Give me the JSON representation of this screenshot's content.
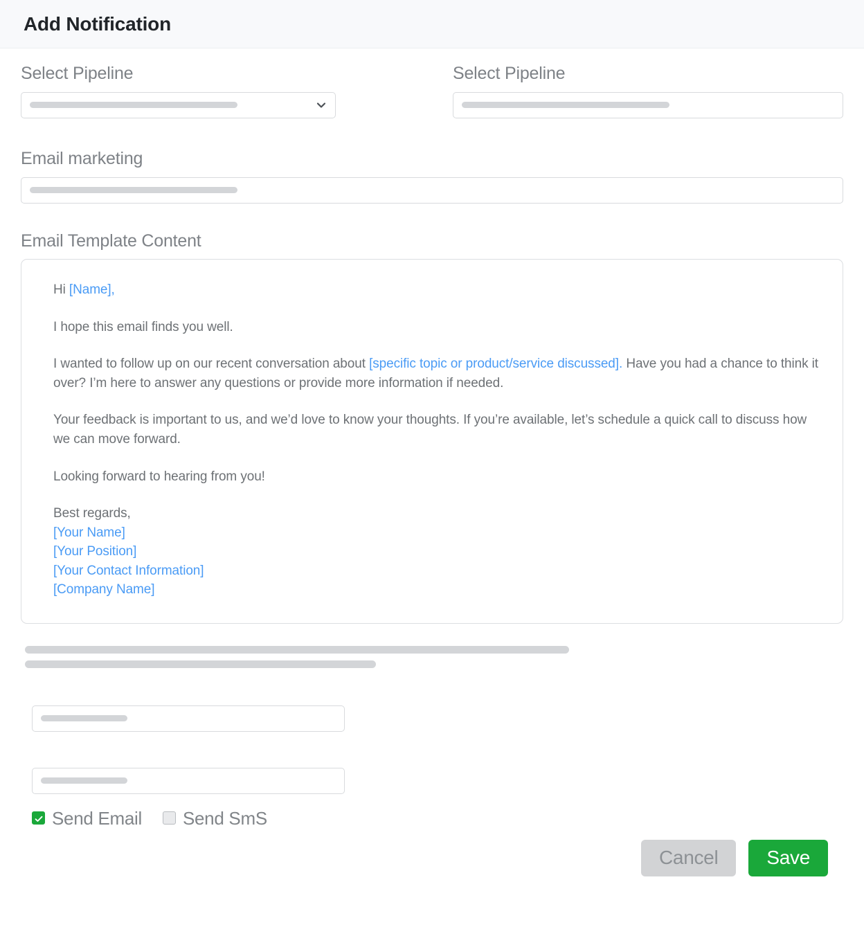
{
  "header": {
    "title": "Add Notification"
  },
  "fields": {
    "pipeline_select": {
      "label": "Select Pipeline",
      "value": "",
      "placeholder": "",
      "icon": "chevron-down-icon"
    },
    "pipeline_input": {
      "label": "Select Pipeline",
      "value": "",
      "placeholder": ""
    },
    "email_marketing": {
      "label": "Email marketing",
      "value": "",
      "placeholder": ""
    },
    "small_input_one": {
      "value": "",
      "placeholder": ""
    },
    "small_input_two": {
      "value": "",
      "placeholder": ""
    }
  },
  "template": {
    "label": "Email Template Content",
    "paragraphs": [
      {
        "id": "greeting",
        "parts": [
          {
            "text": "Hi ",
            "placeholder": false
          },
          {
            "text": "[Name],",
            "placeholder": true
          }
        ]
      },
      {
        "id": "opening",
        "parts": [
          {
            "text": "I hope this email finds you well.",
            "placeholder": false
          }
        ]
      },
      {
        "id": "followup",
        "parts": [
          {
            "text": "I wanted to follow up on our recent conversation about ",
            "placeholder": false
          },
          {
            "text": "[specific topic or product/service discussed].",
            "placeholder": true
          },
          {
            "text": " Have you had a chance to think it over? I’m here to answer any questions or provide more information if needed.",
            "placeholder": false
          }
        ]
      },
      {
        "id": "feedback",
        "parts": [
          {
            "text": "Your feedback is important to us, and we’d love to know your thoughts. If you’re available, let’s schedule a quick call to discuss how we can move forward.",
            "placeholder": false
          }
        ]
      },
      {
        "id": "closing",
        "parts": [
          {
            "text": "Looking forward to hearing from you!",
            "placeholder": false
          }
        ]
      }
    ],
    "signature": {
      "closing": "Best regards,",
      "lines": [
        "[Your Name]",
        "[Your Position]",
        "[Your Contact Information]",
        "[Company Name]"
      ]
    }
  },
  "checkboxes": [
    {
      "id": "send-email",
      "label": "Send Email",
      "checked": true
    },
    {
      "id": "send-sms",
      "label": "Send SmS",
      "checked": false
    }
  ],
  "footer": {
    "cancel_label": "Cancel",
    "save_label": "Save"
  },
  "colors": {
    "accent_green": "#1aa83a",
    "placeholder_blue": "#4a9bf5",
    "cancel_gray": "#d2d3d5",
    "header_bg": "#f8f9fb",
    "skeleton": "#d3d5d8"
  }
}
